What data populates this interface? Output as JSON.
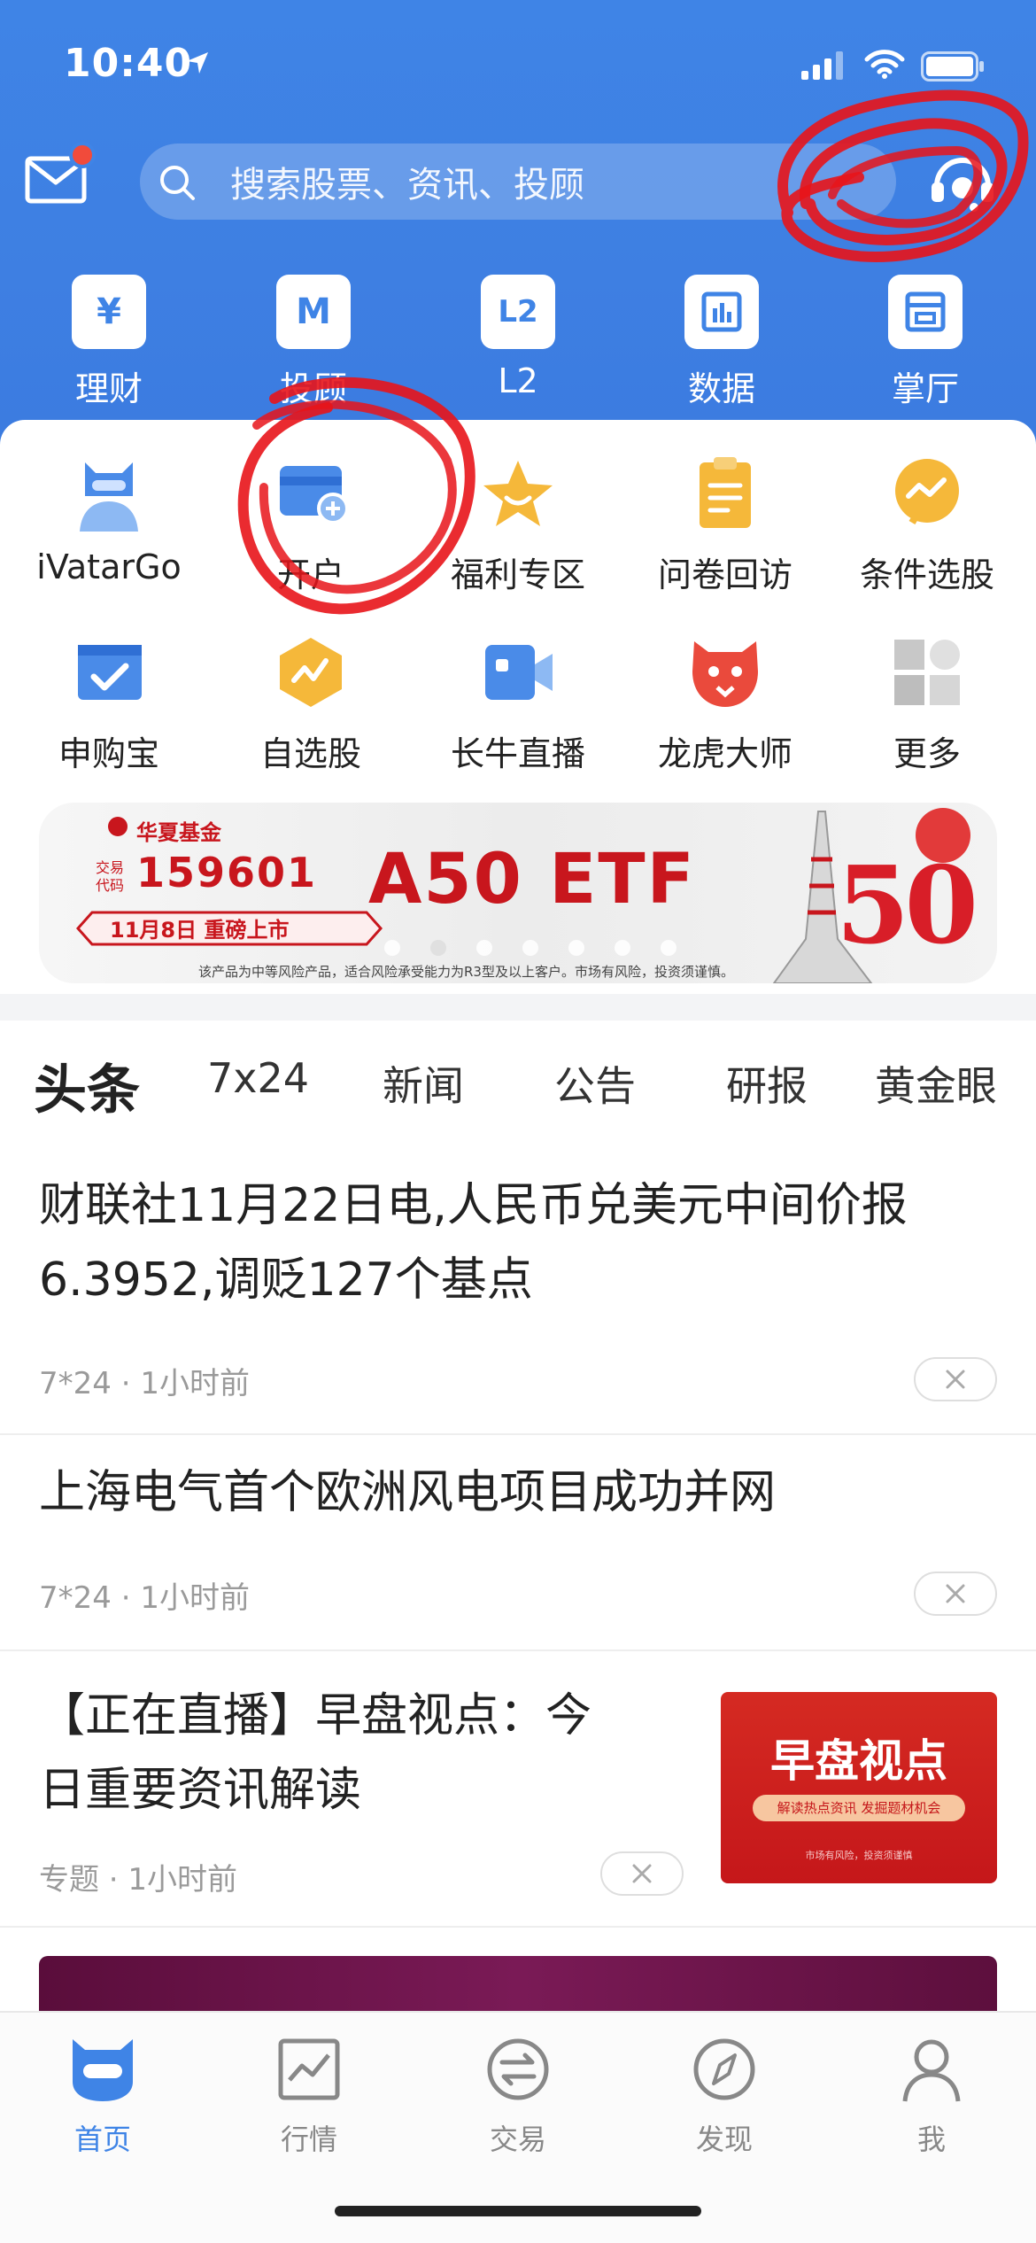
{
  "status": {
    "time": "10:40"
  },
  "search": {
    "placeholder": "搜索股票、资讯、投顾"
  },
  "quick_menu": [
    {
      "label": "理财",
      "icon": "yen-icon",
      "glyph": "¥"
    },
    {
      "label": "投顾",
      "icon": "advisor-icon",
      "glyph": "M"
    },
    {
      "label": "L2",
      "icon": "l2-icon",
      "glyph": "L2"
    },
    {
      "label": "数据",
      "icon": "data-icon",
      "glyph": ""
    },
    {
      "label": "掌厅",
      "icon": "hall-icon",
      "glyph": ""
    }
  ],
  "grid": [
    {
      "label": "iVatarGo",
      "icon": "robot-icon"
    },
    {
      "label": "开户",
      "icon": "card-add-icon"
    },
    {
      "label": "福利专区",
      "icon": "star-icon"
    },
    {
      "label": "问卷回访",
      "icon": "clipboard-icon"
    },
    {
      "label": "条件选股",
      "icon": "chart-bubble-icon"
    },
    {
      "label": "申购宝",
      "icon": "check-box-icon"
    },
    {
      "label": "自选股",
      "icon": "hexagon-icon"
    },
    {
      "label": "长牛直播",
      "icon": "video-icon"
    },
    {
      "label": "龙虎大师",
      "icon": "tiger-icon"
    },
    {
      "label": "更多",
      "icon": "more-grid-icon"
    }
  ],
  "banner": {
    "brand": "华夏基金",
    "code_label": "交易代码",
    "code": "159601",
    "date": "11月8日 重磅上市",
    "title": "A50 ETF",
    "big": "50",
    "disclaimer": "该产品为中等风险产品，适合风险承受能力为R3型及以上客户。市场有风险，投资须谨慎。"
  },
  "tabs": [
    "头条",
    "7x24",
    "新闻",
    "公告",
    "研报",
    "黄金眼"
  ],
  "feed": [
    {
      "title_line1": "财联社11月22日电,人民币兑美元中间价报",
      "title_line2": "6.3952,调贬127个基点",
      "meta": "7*24 · 1小时前"
    },
    {
      "title_line1": "上海电气首个欧洲风电项目成功并网",
      "meta": "7*24 · 1小时前"
    },
    {
      "title_line1": "【正在直播】早盘视点：今",
      "title_line2": "日重要资讯解读",
      "meta": "专题 · 1小时前",
      "thumb": {
        "title": "早盘视点",
        "pill": "解读热点资讯 发掘题材机会",
        "note": "市场有风险，投资须谨慎"
      }
    }
  ],
  "nav": [
    {
      "label": "首页",
      "icon": "home-robot-icon",
      "active": true
    },
    {
      "label": "行情",
      "icon": "market-chart-icon",
      "active": false
    },
    {
      "label": "交易",
      "icon": "trade-exchange-icon",
      "active": false
    },
    {
      "label": "发现",
      "icon": "compass-icon",
      "active": false
    },
    {
      "label": "我",
      "icon": "user-icon",
      "active": false
    }
  ],
  "colors": {
    "primary": "#3f84e6",
    "accent_red": "#c8161d",
    "muted": "#9a9a9a"
  }
}
